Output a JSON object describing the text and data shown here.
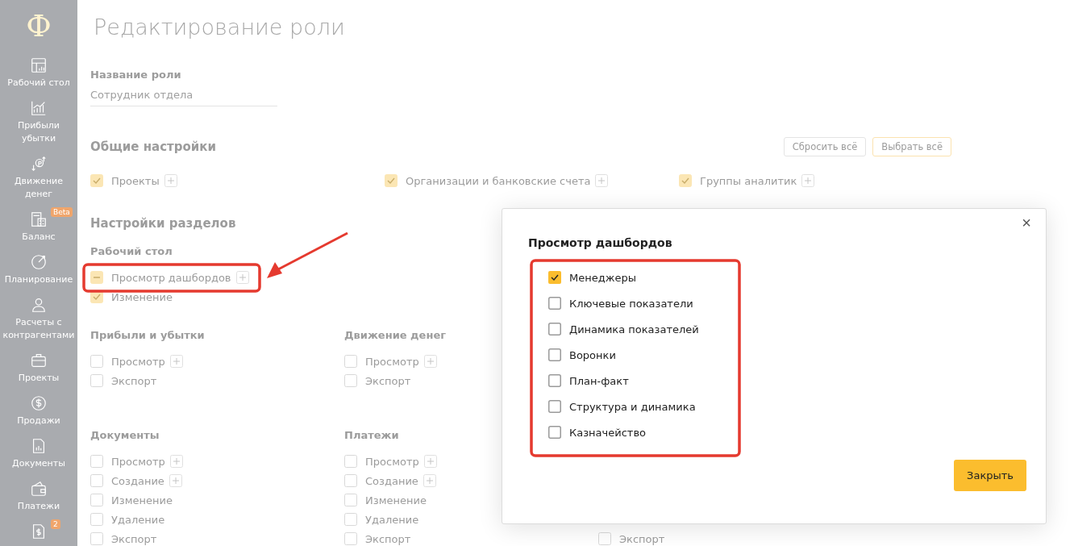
{
  "sidebar": {
    "logo": "Ф",
    "items": [
      {
        "label": "Рабочий стол"
      },
      {
        "label": "Прибыли убытки"
      },
      {
        "label": "Движение денег"
      },
      {
        "label": "Баланс",
        "badge": "Beta"
      },
      {
        "label": "Планирование"
      },
      {
        "label": "Расчеты с контрагентами"
      },
      {
        "label": "Проекты"
      },
      {
        "label": "Продажи"
      },
      {
        "label": "Документы"
      },
      {
        "label": "Платежи"
      },
      {
        "badge": "2"
      }
    ]
  },
  "page": {
    "title": "Редактирование роли",
    "role_name": {
      "label": "Название роли",
      "placeholder": "Сотрудник отдела"
    },
    "general": {
      "title": "Общие настройки",
      "buttons": [
        {
          "label": "Сбросить всё",
          "kind": "secondary"
        },
        {
          "label": "Выбрать всё",
          "kind": "accent"
        }
      ],
      "items": [
        {
          "label": "Проекты",
          "checked": true,
          "partial": false,
          "expandable": true
        },
        {
          "label": "Организации и банковские счета",
          "checked": true,
          "partial": false,
          "expandable": true
        },
        {
          "label": "Группы аналитик",
          "checked": true,
          "partial": false,
          "expandable": true
        }
      ]
    },
    "sections_title": "Настройки разделов",
    "section_rows": [
      [
        {
          "title": "Рабочий стол",
          "items": [
            {
              "label": "Просмотр дашбордов",
              "checked": false,
              "partial": true,
              "expandable": true
            },
            {
              "label": "Изменение",
              "checked": true,
              "partial": false,
              "expandable": false
            }
          ]
        }
      ],
      [
        {
          "title": "Прибыли и убытки",
          "items": [
            {
              "label": "Просмотр",
              "checked": false,
              "partial": false,
              "expandable": true
            },
            {
              "label": "Экспорт",
              "checked": false,
              "partial": false,
              "expandable": false
            }
          ]
        },
        {
          "title": "Движение денег",
          "items": [
            {
              "label": "Просмотр",
              "checked": false,
              "partial": false,
              "expandable": true
            },
            {
              "label": "Экспорт",
              "checked": false,
              "partial": false,
              "expandable": false
            }
          ]
        }
      ],
      [
        {
          "title": "Документы",
          "items": [
            {
              "label": "Просмотр",
              "checked": false,
              "partial": false,
              "expandable": true
            },
            {
              "label": "Создание",
              "checked": false,
              "partial": false,
              "expandable": true
            },
            {
              "label": "Изменение",
              "checked": false,
              "partial": false,
              "expandable": false
            },
            {
              "label": "Удаление",
              "checked": false,
              "partial": false,
              "expandable": false
            },
            {
              "label": "Экспорт",
              "checked": false,
              "partial": false,
              "expandable": false
            }
          ]
        },
        {
          "title": "Платежи",
          "items": [
            {
              "label": "Просмотр",
              "checked": false,
              "partial": false,
              "expandable": true
            },
            {
              "label": "Создание",
              "checked": false,
              "partial": false,
              "expandable": true
            },
            {
              "label": "Изменение",
              "checked": false,
              "partial": false,
              "expandable": false
            },
            {
              "label": "Удаление",
              "checked": false,
              "partial": false,
              "expandable": false
            },
            {
              "label": "Экспорт",
              "checked": false,
              "partial": false,
              "expandable": false
            }
          ]
        },
        {
          "items": [
            {
              "label": "Экспорт",
              "checked": false,
              "partial": false,
              "expandable": false
            }
          ]
        }
      ]
    ]
  },
  "dialog": {
    "title": "Просмотр дашбордов",
    "close": "×",
    "items": [
      {
        "label": "Менеджеры",
        "checked": true
      },
      {
        "label": "Ключевые показатели",
        "checked": false
      },
      {
        "label": "Динамика показателей",
        "checked": false
      },
      {
        "label": "Воронки",
        "checked": false
      },
      {
        "label": "План-факт",
        "checked": false
      },
      {
        "label": "Структура и динамика",
        "checked": false
      },
      {
        "label": "Казначейство",
        "checked": false
      }
    ],
    "button": "Закрыть"
  }
}
